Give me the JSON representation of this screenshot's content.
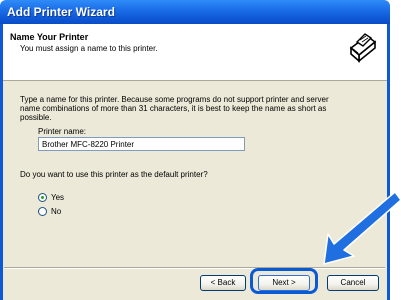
{
  "window": {
    "title": "Add Printer Wizard"
  },
  "header": {
    "title": "Name Your Printer",
    "subtitle": "You must assign a name to this printer."
  },
  "body": {
    "intro_line1": "Type a name for this printer. Because some programs do not support printer and server",
    "intro_line2": "name combinations of more than 31 characters, it is best to keep the name as short as",
    "intro_line3": "possible.",
    "printer_name_label": "Printer name:",
    "printer_name_value": "Brother MFC-8220 Printer",
    "default_question": "Do you want to use this printer as the default printer?",
    "radio_yes": "Yes",
    "radio_no": "No",
    "selected": "Yes"
  },
  "buttons": {
    "back": "< Back",
    "next": "Next >",
    "cancel": "Cancel"
  },
  "colors": {
    "titlebar": "#0f58d6",
    "client": "#ece9d8",
    "highlight": "#0a5ad6",
    "arrow": "#1f6fe0"
  }
}
